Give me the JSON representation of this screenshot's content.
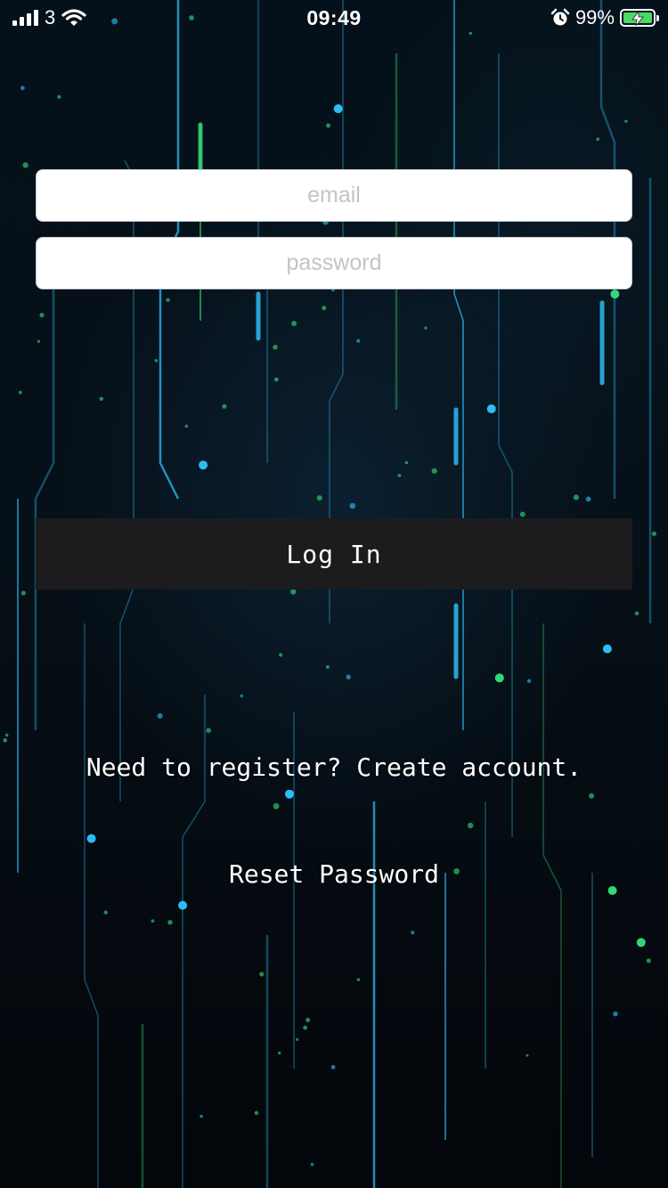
{
  "status_bar": {
    "carrier": "3",
    "time": "09:49",
    "battery_percent": "99%",
    "battery_level": 0.99,
    "battery_color": "#4cd964",
    "icons": [
      "signal-bars-icon",
      "wifi-icon",
      "alarm-clock-icon",
      "battery-charging-icon"
    ]
  },
  "login_form": {
    "email_placeholder": "email",
    "email_value": "",
    "password_placeholder": "password",
    "password_value": "",
    "login_button_label": "Log In"
  },
  "links": {
    "register": "Need to register? Create account.",
    "reset_password": "Reset Password"
  },
  "theme": {
    "background": "#04070c",
    "button_background": "#1c1c1e",
    "circuit_cyan": "#2fc6ff",
    "circuit_green": "#36e27a"
  }
}
